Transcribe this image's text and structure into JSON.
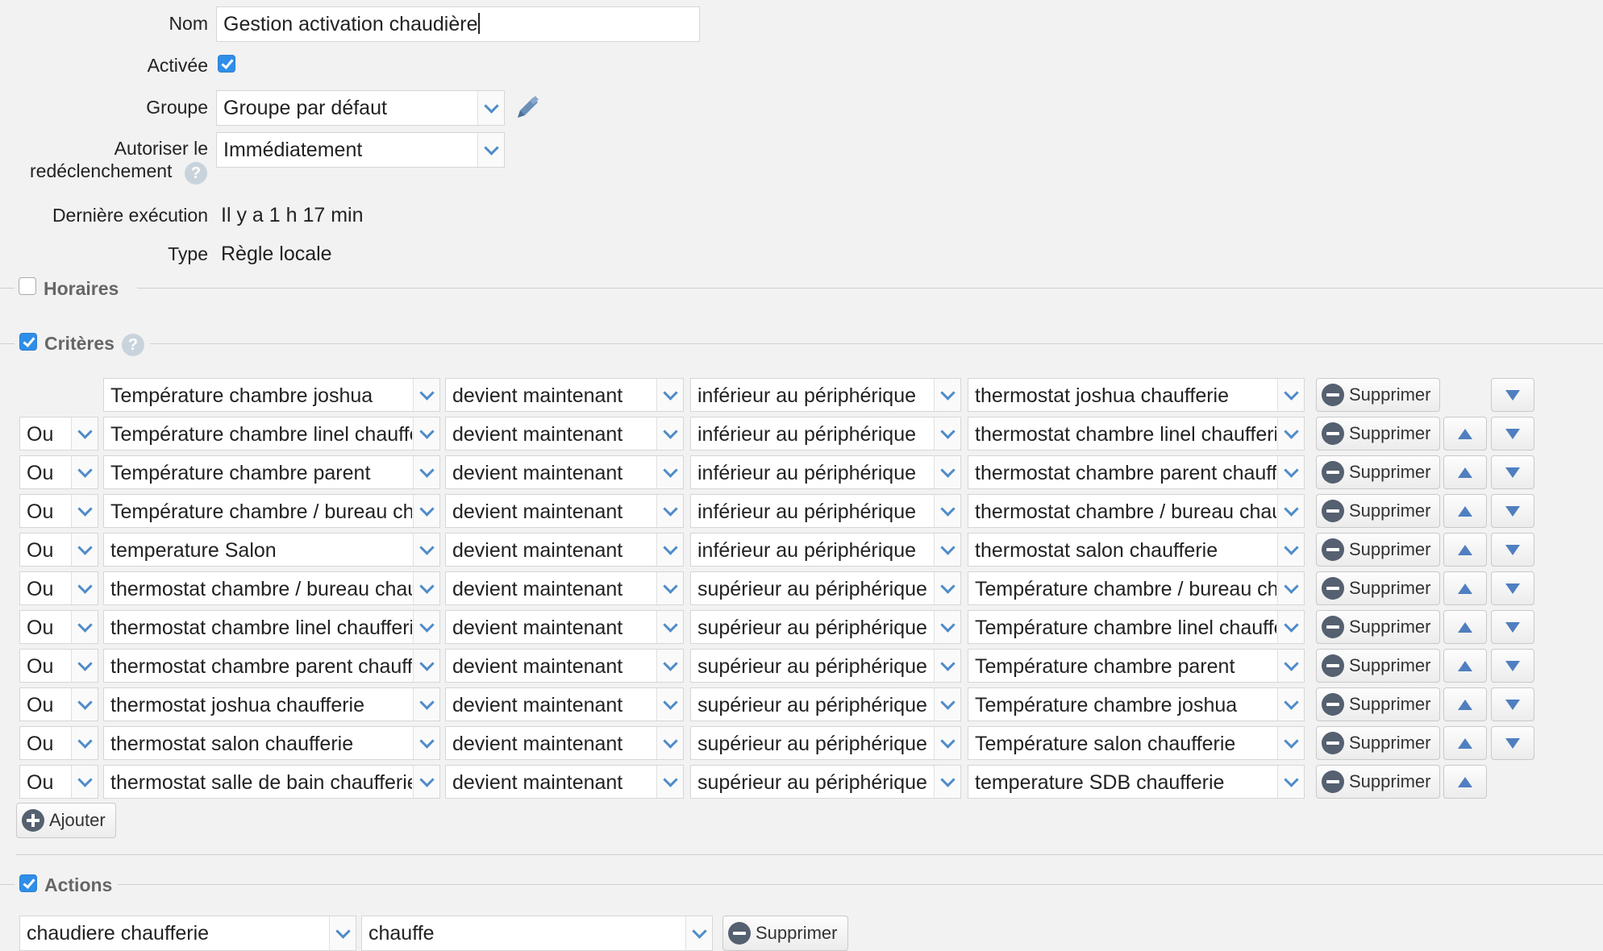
{
  "form": {
    "name_label": "Nom",
    "name_value": "Gestion activation chaudière",
    "enabled_label": "Activée",
    "group_label": "Groupe",
    "group_value": "Groupe par défaut",
    "retrigger_label_1": "Autoriser le",
    "retrigger_label_2": "redéclenchement",
    "retrigger_value": "Immédiatement",
    "last_exec_label": "Dernière exécution",
    "last_exec_value": "Il y a 1 h 17 min",
    "type_label": "Type",
    "type_value": "Règle locale"
  },
  "sections": {
    "schedules": "Horaires",
    "criteria": "Critères",
    "actions": "Actions"
  },
  "help_glyph": "?",
  "criteria_rows": [
    {
      "op": "",
      "device": "Température chambre joshua",
      "event": "devient maintenant",
      "cmp": "inférieur au périphérique",
      "target": "thermostat joshua chaufferie"
    },
    {
      "op": "Ou",
      "device": "Température chambre linel chaufferie",
      "event": "devient maintenant",
      "cmp": "inférieur au périphérique",
      "target": "thermostat chambre linel chaufferie"
    },
    {
      "op": "Ou",
      "device": "Température chambre parent",
      "event": "devient maintenant",
      "cmp": "inférieur au périphérique",
      "target": "thermostat chambre parent chaufferie"
    },
    {
      "op": "Ou",
      "device": "Température chambre / bureau chaufferie",
      "event": "devient maintenant",
      "cmp": "inférieur au périphérique",
      "target": "thermostat chambre / bureau chaufferie"
    },
    {
      "op": "Ou",
      "device": "temperature Salon",
      "event": "devient maintenant",
      "cmp": "inférieur au périphérique",
      "target": "thermostat salon chaufferie"
    },
    {
      "op": "Ou",
      "device": "thermostat chambre / bureau chaufferie",
      "event": "devient maintenant",
      "cmp": "supérieur au périphérique",
      "target": "Température chambre / bureau chaufferie"
    },
    {
      "op": "Ou",
      "device": "thermostat chambre linel chaufferie",
      "event": "devient maintenant",
      "cmp": "supérieur au périphérique",
      "target": "Température chambre linel chaufferie"
    },
    {
      "op": "Ou",
      "device": "thermostat chambre parent chaufferie",
      "event": "devient maintenant",
      "cmp": "supérieur au périphérique",
      "target": "Température chambre parent"
    },
    {
      "op": "Ou",
      "device": "thermostat joshua chaufferie",
      "event": "devient maintenant",
      "cmp": "supérieur au périphérique",
      "target": "Température chambre joshua"
    },
    {
      "op": "Ou",
      "device": "thermostat salon chaufferie",
      "event": "devient maintenant",
      "cmp": "supérieur au périphérique",
      "target": "Température salon chaufferie"
    },
    {
      "op": "Ou",
      "device": "thermostat salle de bain chaufferie",
      "event": "devient maintenant",
      "cmp": "supérieur au périphérique",
      "target": "temperature SDB chaufferie"
    }
  ],
  "buttons": {
    "delete": "Supprimer",
    "add": "Ajouter"
  },
  "actions_rows": [
    {
      "device": "chaudiere chaufferie",
      "value": "chauffe"
    }
  ],
  "colors": {
    "accent": "#2f8ee8",
    "arrow": "#4f7fc0",
    "background": "#f2f2f2"
  },
  "icons": [
    "pencil-icon",
    "help-icon",
    "chevron-down-icon",
    "minus-circle-icon",
    "plus-circle-icon",
    "arrow-up-icon",
    "arrow-down-icon"
  ]
}
